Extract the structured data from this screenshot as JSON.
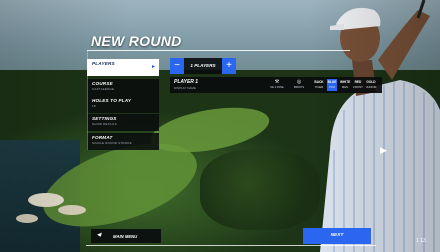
{
  "screen": {
    "title": "NEW ROUND"
  },
  "menu": {
    "items": [
      {
        "label": "PLAYERS",
        "sub": "",
        "active": true
      },
      {
        "label": "COURSE",
        "sub": "CASTLEEDGE"
      },
      {
        "label": "HOLES TO PLAY",
        "sub": "18"
      },
      {
        "label": "SETTINGS",
        "sub": "SHOW DETAILS"
      },
      {
        "label": "FORMAT",
        "sub": "SINGLE ROUND STROKE"
      }
    ]
  },
  "players_stepper": {
    "minus": "−",
    "value": "1 PLAYERS",
    "plus": "+"
  },
  "player_row": {
    "name": "PLAYER 1",
    "sub": "DISPLAY NAME",
    "options": [
      {
        "icon": "golf-club-icon",
        "glyph": "⚒",
        "label": "DE 3 PANE"
      },
      {
        "icon": "target-icon",
        "glyph": "◎",
        "label": "BIRDITS"
      }
    ],
    "tees": [
      {
        "code": "BACK",
        "label": "TIGER"
      },
      {
        "code": "BLUE",
        "label": "PRO",
        "selected": true
      },
      {
        "code": "WHITE",
        "label": "MEN"
      },
      {
        "code": "RED",
        "label": "FRONT"
      },
      {
        "code": "GOLD",
        "label": "JUNIOR"
      }
    ]
  },
  "side_arrow": "▶",
  "bottom": {
    "main_menu_label": "MAIN MENU",
    "main_menu_arrow": "◀",
    "next_label": "NEXT",
    "corner_text": "1 13"
  }
}
